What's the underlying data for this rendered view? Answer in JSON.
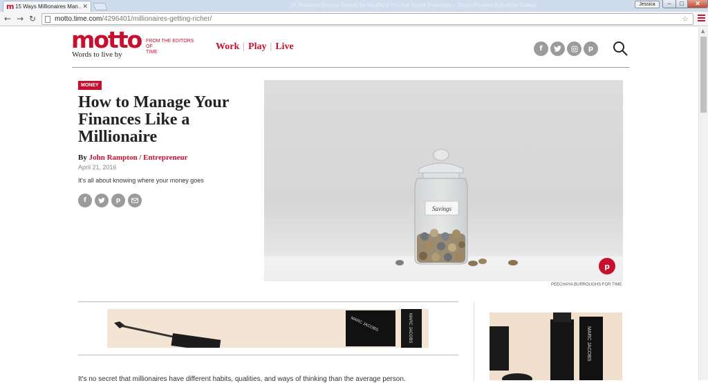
{
  "browser": {
    "tab_title": "15 Ways Millionaires Man…",
    "tab_favicon": "m",
    "window_title": "15 Reasons Brands Should be Mindful if You Are Social Followers – Word (Product Activation Failed)",
    "user": "Jessica",
    "url_domain": "motto.time.com",
    "url_path": "/4296401/millionaires-getting-richer/"
  },
  "site": {
    "logo": "motto",
    "tagline": "Words to live by",
    "from_editors": "FROM THE EDITORS OF",
    "time_label": "TIME",
    "nav": [
      "Work",
      "Play",
      "Live"
    ],
    "accent_color": "#c8102e"
  },
  "article": {
    "tag": "MONEY",
    "headline": "How to Manage Your Finances Like a Millionaire",
    "by_prefix": "By ",
    "author": "John Rampton / Entrepreneur",
    "date": "April 21, 2016",
    "dek": "It's all about knowing where your money goes",
    "hero_label": "Savings",
    "photo_credit": "PEECHAYA BURROUGHS FOR TIME",
    "body_start": "It's no secret that millionaires have different habits, qualities, and ways of thinking than the average person."
  },
  "ads": {
    "brand": "MARC JACOBS"
  },
  "icons": {
    "social": [
      "facebook-icon",
      "twitter-icon",
      "instagram-icon",
      "pinterest-icon"
    ],
    "share": [
      "facebook-icon",
      "twitter-icon",
      "pinterest-icon",
      "email-icon"
    ]
  }
}
